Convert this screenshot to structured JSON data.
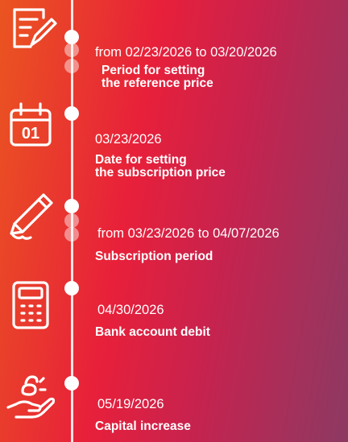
{
  "colors": {
    "gradient_start": "#ea5520",
    "gradient_mid": "#e8203a",
    "gradient_end": "#8c3a63",
    "foreground": "#ffffff"
  },
  "timeline": {
    "steps": [
      {
        "icon": "document-pen-icon",
        "date": "from 02/23/2026 to 03/20/2026",
        "title_line1": "Period for setting",
        "title_line2": "the reference price"
      },
      {
        "icon": "calendar-icon",
        "icon_text": "01",
        "date": "03/23/2026",
        "title_line1": "Date for setting",
        "title_line2": "the subscription price"
      },
      {
        "icon": "pen-icon",
        "date": "from 03/23/2026 to 04/07/2026",
        "title_line1": "Subscription period"
      },
      {
        "icon": "calculator-icon",
        "date": "04/30/2026",
        "title_line1": "Bank account debit"
      },
      {
        "icon": "hand-coins-icon",
        "date": "05/19/2026",
        "title_line1": "Capital increase"
      }
    ]
  }
}
